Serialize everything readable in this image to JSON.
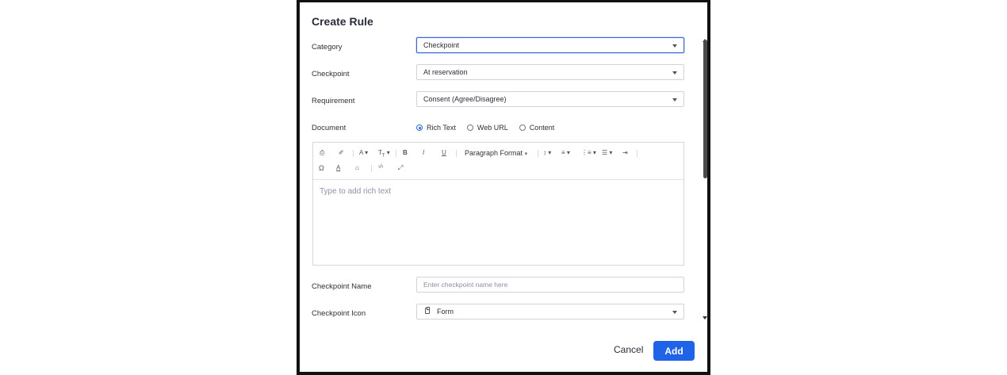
{
  "dialog": {
    "title": "Create Rule",
    "fields": {
      "category": {
        "label": "Category",
        "value": "Checkpoint"
      },
      "checkpoint": {
        "label": "Checkpoint",
        "value": "At reservation"
      },
      "requirement": {
        "label": "Requirement",
        "value": "Consent (Agree/Disagree)"
      },
      "document": {
        "label": "Document",
        "options": [
          {
            "label": "Rich Text",
            "selected": true
          },
          {
            "label": "Web URL",
            "selected": false
          },
          {
            "label": "Content",
            "selected": false
          }
        ]
      },
      "checkpoint_name": {
        "label": "Checkpoint Name",
        "value": "",
        "placeholder": "Enter checkpoint name here"
      },
      "checkpoint_icon": {
        "label": "Checkpoint Icon",
        "value": "Form",
        "icon": "clipboard-icon"
      }
    },
    "editor": {
      "paragraph_format": "Paragraph Format",
      "placeholder": "Type to add rich text",
      "tools": [
        "print",
        "clear-format",
        "font-family",
        "font-size",
        "bold",
        "italic",
        "underline",
        "paragraph-format",
        "line-height",
        "align",
        "ordered-list",
        "unordered-list",
        "indent",
        "special-characters",
        "text-color",
        "background-color",
        "code-view",
        "fullscreen"
      ]
    },
    "buttons": {
      "cancel": "Cancel",
      "add": "Add"
    },
    "colors": {
      "primary": "#1f63e6",
      "focus_border": "#3a68d8"
    }
  }
}
